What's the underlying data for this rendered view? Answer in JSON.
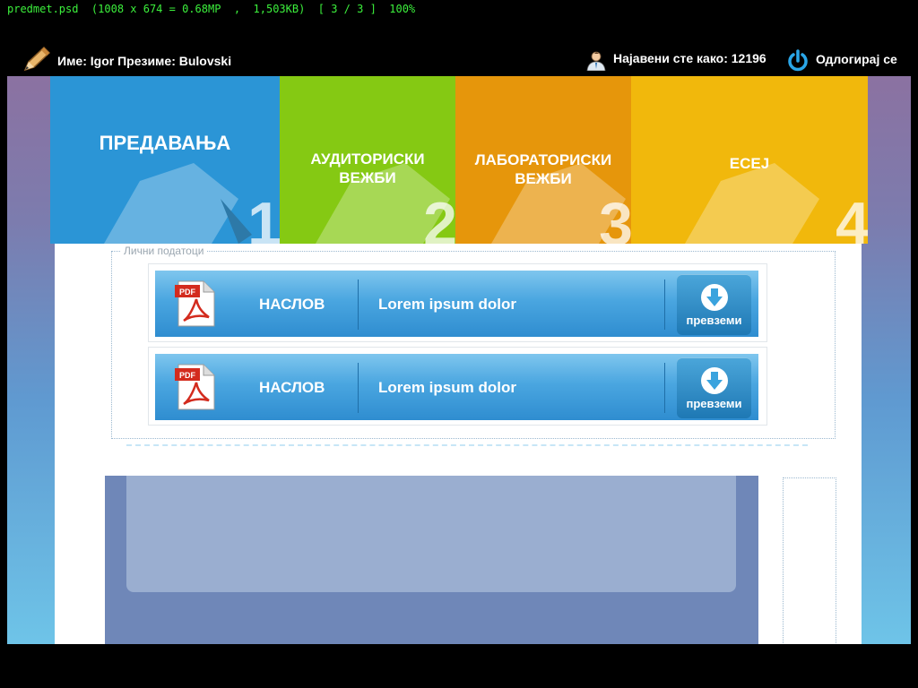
{
  "viewer": {
    "title": "predmet.psd  (1008 x 674 = 0.68MP  ,  1,503KB)  [ 3 / 3 ]  100%"
  },
  "header": {
    "user_name": "Име: Igor Презиме: Bulovski",
    "logged_as": "Најавени сте како: 12196",
    "logout": "Одлогирај се",
    "icons": [
      "pencil-icon",
      "user-icon",
      "power-icon"
    ]
  },
  "tiles": [
    {
      "label": "ПРЕДАВАЊА",
      "number": "1",
      "color": "#2b95d6"
    },
    {
      "label": "АУДИТОРИСКИ ВЕЖБИ",
      "number": "2",
      "color": "#85c913"
    },
    {
      "label": "ЛАБОРАТОРИСКИ ВЕЖБИ",
      "number": "3",
      "color": "#e6960b"
    },
    {
      "label": "ЕСЕЈ",
      "number": "4",
      "color": "#f1b80c"
    }
  ],
  "personal": {
    "legend": "Лични податоци",
    "files": [
      {
        "badge": "PDF",
        "title": "НАСЛОВ",
        "description": "Lorem ipsum dolor",
        "button": "превземи"
      },
      {
        "badge": "PDF",
        "title": "НАСЛОВ",
        "description": "Lorem ipsum dolor",
        "button": "превземи"
      }
    ]
  },
  "colors": {
    "accent": "#2f8dd0",
    "panel": "#6f87b8"
  }
}
